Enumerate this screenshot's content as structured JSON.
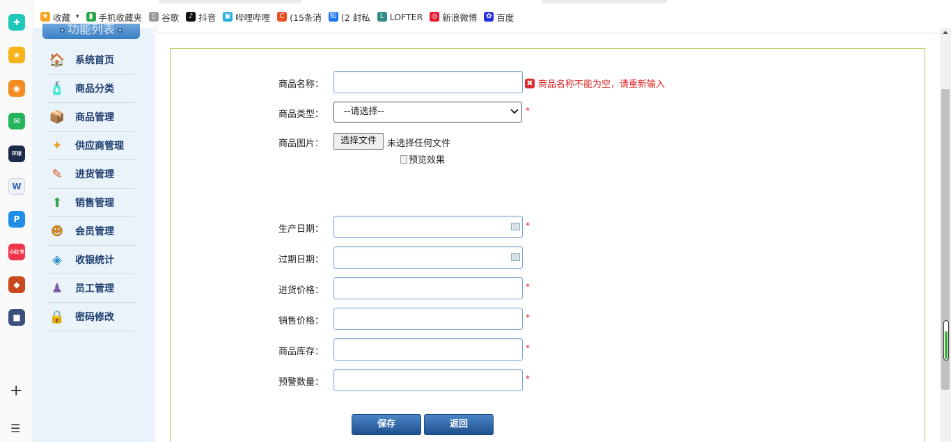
{
  "bookmarks": [
    {
      "label": "收藏",
      "icon": "star-icon",
      "color": "#f5a623"
    },
    {
      "label": "手机收藏夹",
      "icon": "phone-icon",
      "color": "#2aa84a"
    },
    {
      "label": "谷歌",
      "icon": "page-icon",
      "color": "#999999"
    },
    {
      "label": "抖音",
      "icon": "douyin-icon",
      "color": "#111111"
    },
    {
      "label": "哔哩哔哩",
      "icon": "bilibili-icon",
      "color": "#23ade5"
    },
    {
      "label": "(15条消",
      "icon": "csdn-icon",
      "color": "#e8501f"
    },
    {
      "label": "(2 封私",
      "icon": "zhihu-icon",
      "color": "#1772f6"
    },
    {
      "label": "LOFTER",
      "icon": "lofter-icon",
      "color": "#2d8a84"
    },
    {
      "label": "新浪微博",
      "icon": "weibo-icon",
      "color": "#e6162d"
    },
    {
      "label": "百度",
      "icon": "baidu-paw-icon",
      "color": "#2932e1"
    }
  ],
  "sidebar": {
    "title": "功能列表",
    "items": [
      {
        "label": "系统首页",
        "icon": "home-icon"
      },
      {
        "label": "商品分类",
        "icon": "category-icon"
      },
      {
        "label": "商品管理",
        "icon": "goods-icon"
      },
      {
        "label": "供应商管理",
        "icon": "supplier-icon"
      },
      {
        "label": "进货管理",
        "icon": "purchase-icon"
      },
      {
        "label": "销售管理",
        "icon": "sales-icon"
      },
      {
        "label": "会员管理",
        "icon": "members-icon"
      },
      {
        "label": "收银统计",
        "icon": "cashier-icon"
      },
      {
        "label": "员工管理",
        "icon": "staff-icon"
      },
      {
        "label": "密码修改",
        "icon": "password-icon"
      }
    ]
  },
  "form": {
    "name_label": "商品名称：",
    "name_value": "",
    "name_error": "商品名称不能为空，请重新输入",
    "type_label": "商品类型：",
    "type_selected": "--请选择--",
    "image_label": "商品图片：",
    "file_button": "选择文件",
    "file_status": "未选择任何文件",
    "preview_alt": "预览效果",
    "prod_date_label": "生产日期：",
    "exp_date_label": "过期日期：",
    "purchase_price_label": "进货价格：",
    "sale_price_label": "销售价格：",
    "stock_label": "商品库存：",
    "warn_label": "预警数量：",
    "required_mark": "*",
    "save_label": "保存",
    "back_label": "返回"
  },
  "colors": {
    "accent": "#2f6db5",
    "error": "#dd2222",
    "form_border": "#b9c74f",
    "sidebar_bg": "#eaf2fa"
  }
}
